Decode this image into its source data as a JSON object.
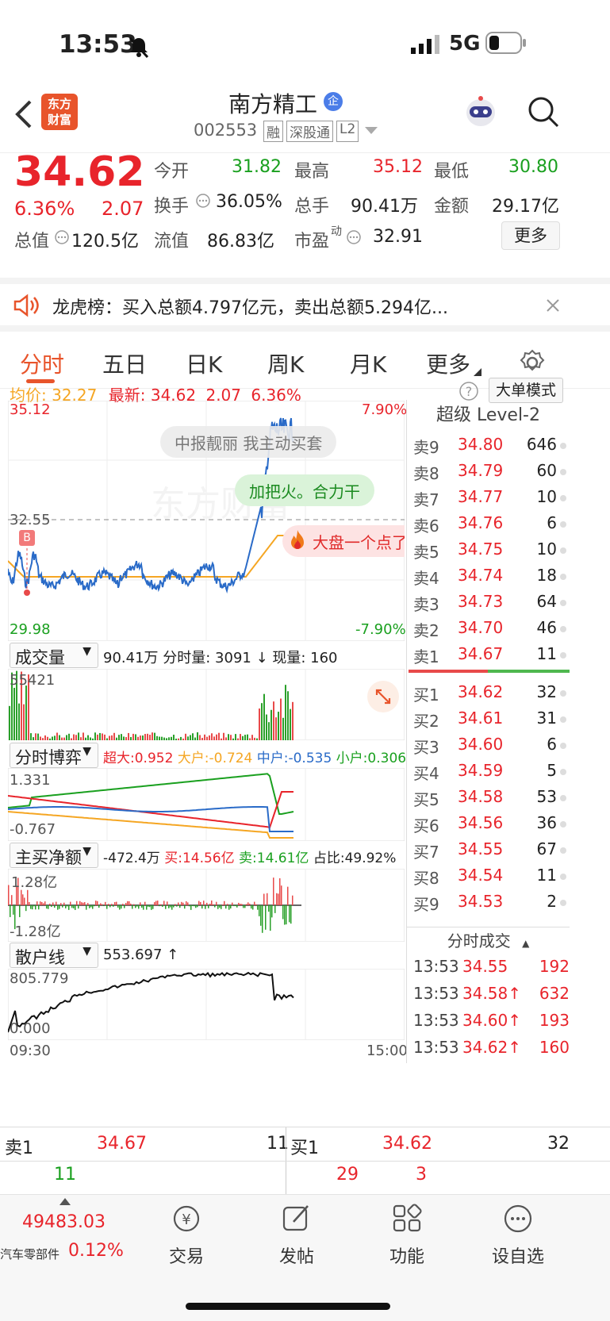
{
  "status": {
    "time": "13:53",
    "network": "5G"
  },
  "nav": {
    "logo_line1": "东方",
    "logo_line2": "财富",
    "title": "南方精工",
    "badge": "企",
    "code": "002553",
    "tags": [
      "融",
      "深股通",
      "L2"
    ]
  },
  "quote": {
    "price": "34.62",
    "pct": "6.36%",
    "chg": "2.07",
    "labels": {
      "open": "今开",
      "high": "最高",
      "low": "最低",
      "turnover": "换手",
      "volume": "总手",
      "amount": "金额",
      "mktcap": "总值",
      "float": "流值",
      "pe": "市盈",
      "pe_sup": "动"
    },
    "open": "31.82",
    "high": "35.12",
    "low": "30.80",
    "turnover": "36.05%",
    "volume": "90.41万",
    "amount": "29.17亿",
    "mktcap": "120.5亿",
    "float": "86.83亿",
    "pe": "32.91",
    "more": "更多"
  },
  "notice": {
    "text": "龙虎榜：买入总额4.797亿元，卖出总额5.294亿..."
  },
  "tabs": [
    "分时",
    "五日",
    "日K",
    "周K",
    "月K",
    "更多"
  ],
  "chart": {
    "avg_label": "均价:",
    "avg": "32.27",
    "latest_label": "最新:",
    "latest": "34.62",
    "chg": "2.07",
    "pct": "6.36%",
    "mode": "大单模式",
    "y_top": "35.12",
    "y_mid": "32.55",
    "y_bot": "29.98",
    "pct_top": "7.90%",
    "pct_bot": "-7.90%",
    "bubble1": "中报靓丽 我主动买套",
    "bubble2": "加把火。合力干",
    "bubble3": "大盘一个点了",
    "marker": "B",
    "watermark": "东方财富"
  },
  "volume": {
    "selector": "成交量",
    "summary": "90.41万 分时量: 3091 ↓ 现量: 160",
    "max": "55421"
  },
  "game": {
    "selector": "分时博弈",
    "super": "超大:0.952",
    "large": "大户:-0.724",
    "mid": "中户:-0.535",
    "small": "小户:0.306",
    "max": "1.331",
    "min": "-0.767"
  },
  "netbuy": {
    "selector": "主买净额",
    "value": "-472.4万",
    "buy": "买:14.56亿",
    "sell": "卖:14.61亿",
    "ratio": "占比:49.92%",
    "max": "1.28亿",
    "min": "-1.28亿"
  },
  "retail": {
    "selector": "散户线",
    "value": "553.697 ↑",
    "max": "805.779",
    "min": "0.000",
    "t_start": "09:30",
    "t_end": "15:00"
  },
  "level2": {
    "title": "超级 Level-2",
    "sells": [
      {
        "label": "卖9",
        "price": "34.80",
        "vol": "646"
      },
      {
        "label": "卖8",
        "price": "34.79",
        "vol": "60"
      },
      {
        "label": "卖7",
        "price": "34.77",
        "vol": "10"
      },
      {
        "label": "卖6",
        "price": "34.76",
        "vol": "6"
      },
      {
        "label": "卖5",
        "price": "34.75",
        "vol": "10"
      },
      {
        "label": "卖4",
        "price": "34.74",
        "vol": "18"
      },
      {
        "label": "卖3",
        "price": "34.73",
        "vol": "64"
      },
      {
        "label": "卖2",
        "price": "34.70",
        "vol": "46"
      },
      {
        "label": "卖1",
        "price": "34.67",
        "vol": "11"
      }
    ],
    "buys": [
      {
        "label": "买1",
        "price": "34.62",
        "vol": "32"
      },
      {
        "label": "买2",
        "price": "34.61",
        "vol": "31"
      },
      {
        "label": "买3",
        "price": "34.60",
        "vol": "6"
      },
      {
        "label": "买4",
        "price": "34.59",
        "vol": "5"
      },
      {
        "label": "买5",
        "price": "34.58",
        "vol": "53"
      },
      {
        "label": "买6",
        "price": "34.56",
        "vol": "36"
      },
      {
        "label": "买7",
        "price": "34.55",
        "vol": "67"
      },
      {
        "label": "买8",
        "price": "34.54",
        "vol": "11"
      },
      {
        "label": "买9",
        "price": "34.53",
        "vol": "2"
      }
    ],
    "trades_title": "分时成交",
    "trades": [
      {
        "time": "13:53",
        "price": "34.55",
        "vol": "192"
      },
      {
        "time": "13:53",
        "price": "34.58↑",
        "vol": "632"
      },
      {
        "time": "13:53",
        "price": "34.60↑",
        "vol": "193"
      },
      {
        "time": "13:53",
        "price": "34.62↑",
        "vol": "160"
      }
    ]
  },
  "bottom": {
    "sell_label": "卖1",
    "sell_price": "34.67",
    "sell_vol": "11",
    "sell_sub": "11",
    "buy_label": "买1",
    "buy_price": "34.62",
    "buy_vol": "32",
    "buy_sub1": "29",
    "buy_sub2": "3"
  },
  "toolbar": {
    "index_value": "49483.03",
    "index_name": "汽车零部件",
    "index_pct": "0.12%",
    "trade": "交易",
    "trade_icon": "¥",
    "post": "发帖",
    "func": "功能",
    "watch": "设自选"
  }
}
